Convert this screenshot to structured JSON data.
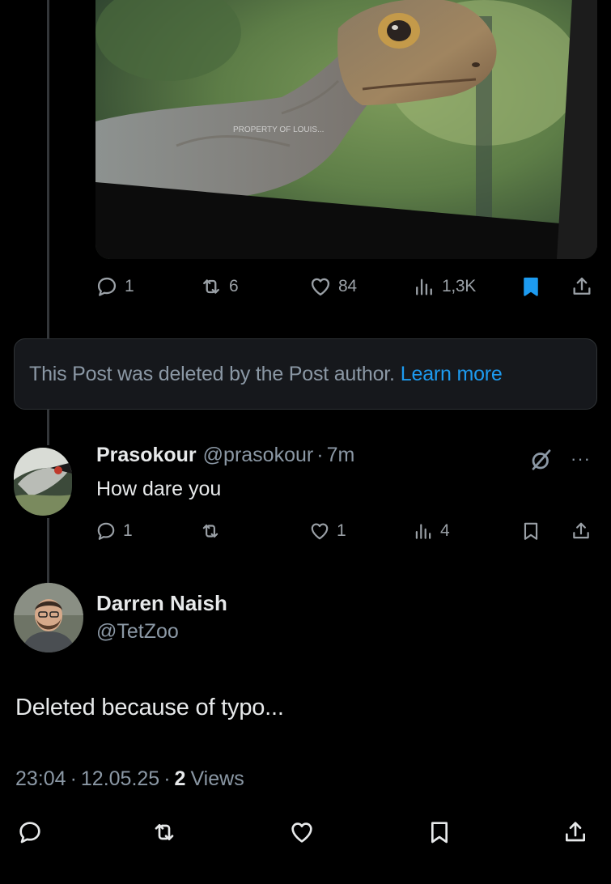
{
  "media": {
    "watermark": "PROPERTY OF LOUIS..."
  },
  "quoted_post": {
    "stats": {
      "replies": "1",
      "reposts": "6",
      "likes": "84",
      "views": "1,3K"
    },
    "bookmarked": true
  },
  "deleted_notice": {
    "text": "This Post was deleted by the Post author.",
    "link": "Learn more"
  },
  "reply": {
    "name": "Prasokour",
    "handle": "@prasokour",
    "separator": "·",
    "time": "7m",
    "text": "How dare you",
    "stats": {
      "replies": "1",
      "reposts": "",
      "likes": "1",
      "views": "4"
    },
    "more": "···"
  },
  "main_post": {
    "name": "Darren Naish",
    "handle": "@TetZoo",
    "text": "Deleted because of typo...",
    "time": "23:04",
    "date": "12.05.25",
    "separator": "·",
    "views_count": "2",
    "views_label": "Views"
  },
  "icons": {
    "reply": "reply-icon",
    "repost": "repost-icon",
    "like": "heart-icon",
    "views": "views-icon",
    "bookmark": "bookmark-icon",
    "share": "share-icon",
    "grok": "grok-icon",
    "more": "more-icon"
  },
  "colors": {
    "background": "#000000",
    "text_primary": "#e7e9ea",
    "text_secondary": "#8b98a5",
    "accent": "#1d9bf0",
    "card_bg": "#16181c"
  }
}
